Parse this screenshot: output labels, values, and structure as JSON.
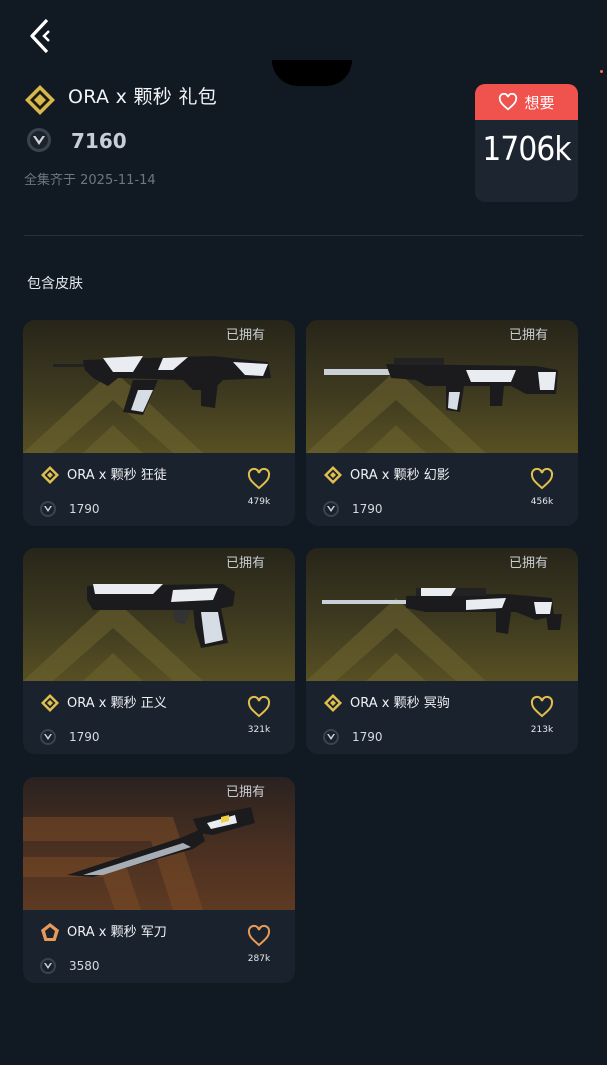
{
  "nav": {
    "back_icon": "chevron-left-icon"
  },
  "bundle": {
    "title": "ORA x 颗秒 礼包",
    "price": "7160",
    "collected": "全集齐于 2025-11-14",
    "want_label": "想要",
    "want_count": "1706k",
    "tier_color": "#d8b84a"
  },
  "section": {
    "title": "包含皮肤"
  },
  "skins": [
    {
      "name": "ORA x 颗秒 狂徒",
      "price": "1790",
      "likes": "479k",
      "owned": "已拥有",
      "tier": "gold"
    },
    {
      "name": "ORA x 颗秒 幻影",
      "price": "1790",
      "likes": "456k",
      "owned": "已拥有",
      "tier": "gold"
    },
    {
      "name": "ORA x 颗秒 正义",
      "price": "1790",
      "likes": "321k",
      "owned": "已拥有",
      "tier": "gold"
    },
    {
      "name": "ORA x 颗秒 冥驹",
      "price": "1790",
      "likes": "213k",
      "owned": "已拥有",
      "tier": "gold"
    },
    {
      "name": "ORA x 颗秒 军刀",
      "price": "3580",
      "likes": "287k",
      "owned": "已拥有",
      "tier": "orange"
    }
  ],
  "colors": {
    "accent_red": "#f0524e",
    "gold": "#e0bf4c",
    "orange": "#e89a5a",
    "background": "#111923"
  }
}
